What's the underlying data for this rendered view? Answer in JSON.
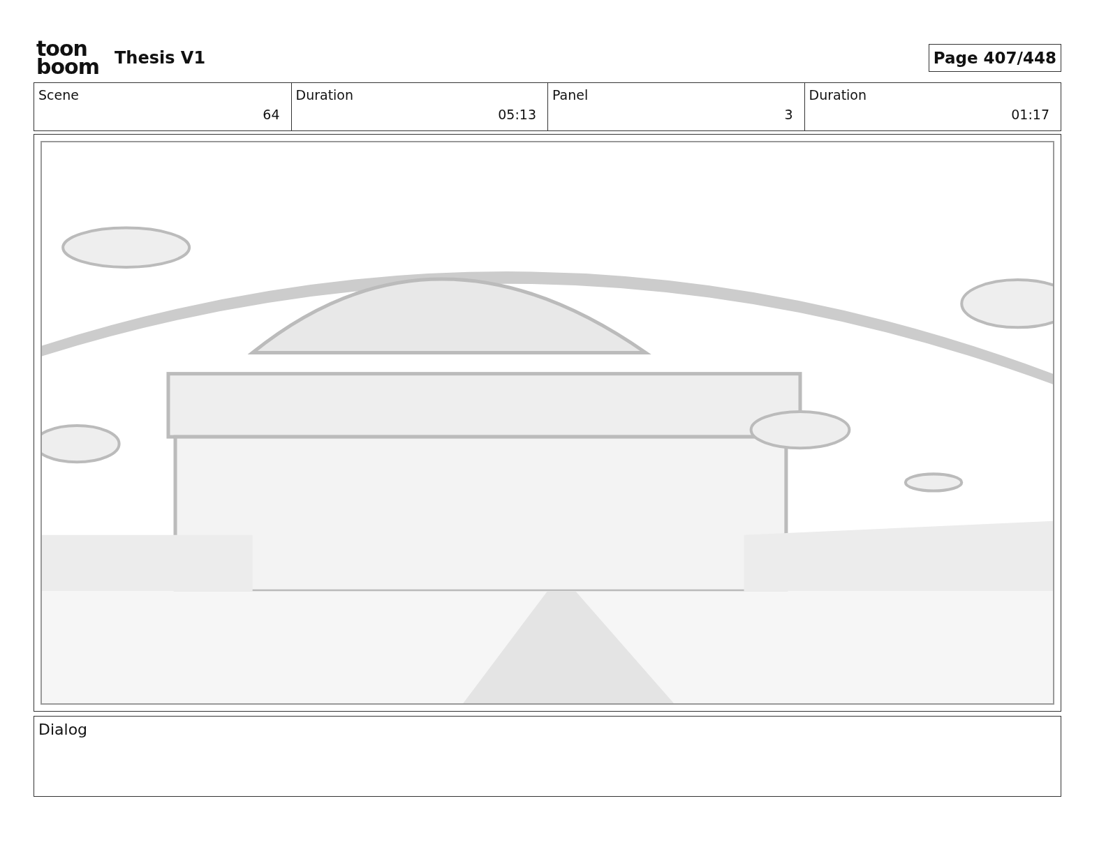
{
  "header": {
    "logo": [
      "toon",
      "boom"
    ],
    "title": "Thesis V1",
    "page": "Page 407/448"
  },
  "info": [
    {
      "label": "Scene",
      "value": "64"
    },
    {
      "label": "Duration",
      "value": "05:13"
    },
    {
      "label": "Panel",
      "value": "3"
    },
    {
      "label": "Duration",
      "value": "01:17"
    }
  ],
  "dialog": {
    "label": "Dialog"
  }
}
